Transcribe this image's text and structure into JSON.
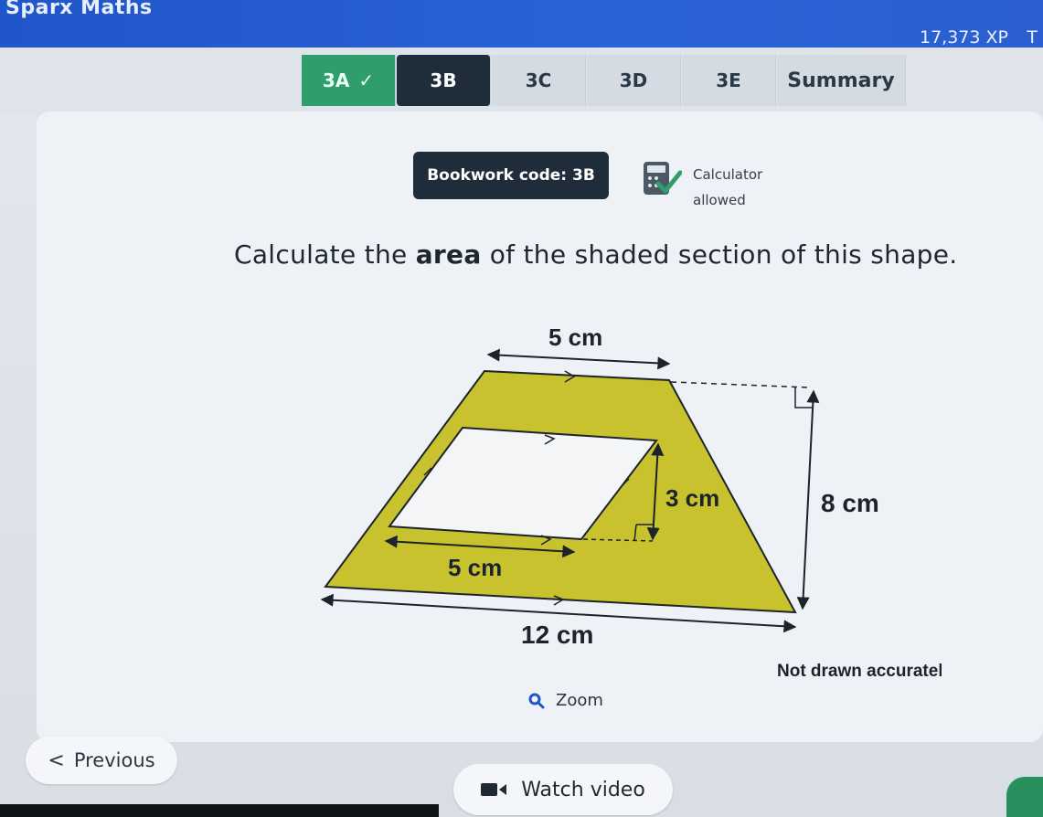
{
  "header": {
    "brand": "Sparx Maths",
    "xp": "17,373 XP",
    "extra": "T"
  },
  "tabs": [
    {
      "label": "3A",
      "state": "done",
      "tick": "✓"
    },
    {
      "label": "3B",
      "state": "active"
    },
    {
      "label": "3C",
      "state": "normal"
    },
    {
      "label": "3D",
      "state": "normal"
    },
    {
      "label": "3E",
      "state": "normal"
    },
    {
      "label": "Summary",
      "state": "normal"
    }
  ],
  "bookwork": {
    "label": "Bookwork code: 3B"
  },
  "calculator": {
    "line1": "Calculator",
    "line2": "allowed"
  },
  "question": {
    "before": "Calculate the ",
    "bold": "area",
    "after": " of the shaded section of this shape."
  },
  "diagram": {
    "top_label": "5 cm",
    "height_label": "8 cm",
    "inner_height_label": "3 cm",
    "inner_base_label": "5 cm",
    "bottom_label": "12 cm",
    "note": "Not drawn accurately",
    "fill_color": "#c8c22f"
  },
  "zoom": {
    "label": "Zoom"
  },
  "nav": {
    "previous_chevron": "<",
    "previous": "Previous",
    "watch_video": "Watch video"
  },
  "colors": {
    "header": "#2a63d8",
    "done_tab": "#2f9d6c",
    "active_tab": "#1f2d3a"
  }
}
